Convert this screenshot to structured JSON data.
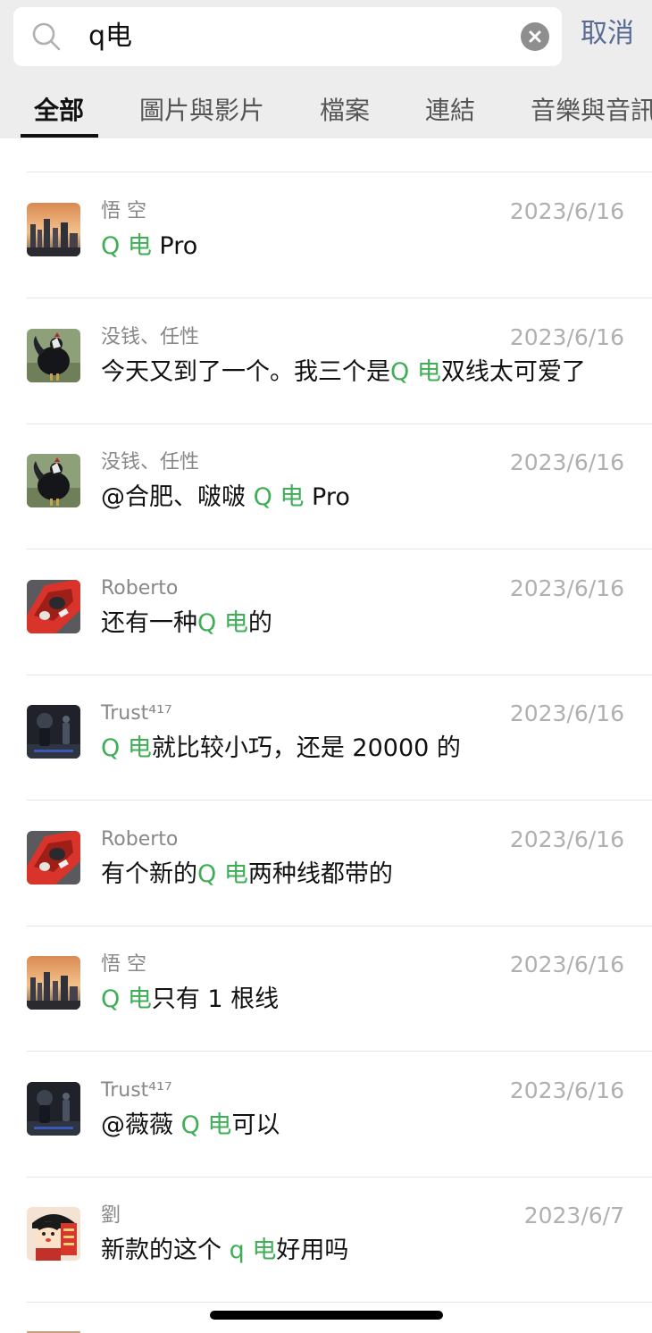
{
  "search": {
    "query": "q电",
    "cancel_label": "取消"
  },
  "tabs": [
    {
      "label": "全部",
      "active": true
    },
    {
      "label": "圖片與影片",
      "active": false
    },
    {
      "label": "檔案",
      "active": false
    },
    {
      "label": "連結",
      "active": false
    },
    {
      "label": "音樂與音訊",
      "active": false
    }
  ],
  "colors": {
    "highlight": "#3fae56",
    "link": "#576b95",
    "header_bg": "#ededed"
  },
  "results": [
    {
      "sender": "悟 空",
      "date": "2023/6/16",
      "avatar": "city-sunset-avatar",
      "msg": {
        "before": "",
        "hl": "Q 电",
        "after": " Pro"
      }
    },
    {
      "sender": "没钱、任性",
      "date": "2023/6/16",
      "avatar": "rooster-avatar",
      "msg": {
        "before": "今天又到了一个。我三个是",
        "hl": "Q 电",
        "after": "双线太可爱了"
      }
    },
    {
      "sender": "没钱、任性",
      "date": "2023/6/16",
      "avatar": "rooster-avatar",
      "msg": {
        "before": "@合肥、啵啵 ",
        "hl": "Q 电",
        "after": " Pro"
      }
    },
    {
      "sender": "Roberto",
      "date": "2023/6/16",
      "avatar": "red-car-avatar",
      "msg": {
        "before": "还有一种",
        "hl": "Q 电",
        "after": "的"
      }
    },
    {
      "sender": "Trust⁴¹⁷",
      "date": "2023/6/16",
      "avatar": "night-figure-avatar",
      "msg": {
        "before": "",
        "hl": "Q 电",
        "after": "就比较小巧，还是 20000 的"
      }
    },
    {
      "sender": "Roberto",
      "date": "2023/6/16",
      "avatar": "red-car-avatar",
      "msg": {
        "before": "有个新的",
        "hl": "Q 电",
        "after": "两种线都带的"
      }
    },
    {
      "sender": "悟 空",
      "date": "2023/6/16",
      "avatar": "city-sunset-avatar",
      "msg": {
        "before": "",
        "hl": "Q 电",
        "after": "只有 1 根线"
      }
    },
    {
      "sender": "Trust⁴¹⁷",
      "date": "2023/6/16",
      "avatar": "night-figure-avatar",
      "msg": {
        "before": "@薇薇 ",
        "hl": "Q 电",
        "after": "可以"
      }
    },
    {
      "sender": "劉",
      "date": "2023/6/7",
      "avatar": "cartoon-boy-avatar",
      "msg": {
        "before": "新款的这个 ",
        "hl": "q 电",
        "after": "好用吗"
      }
    }
  ]
}
